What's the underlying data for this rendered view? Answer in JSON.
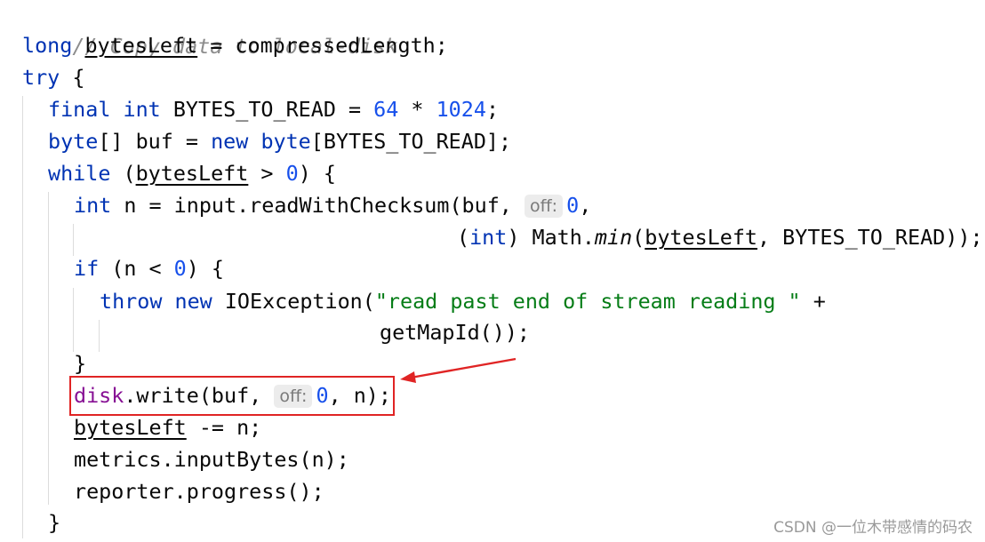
{
  "code": {
    "comment": "// Copy data to local-disk",
    "l1_kw": "long",
    "l1_var": "bytesLeft",
    "l1_rest": " = compressedLength;",
    "l2_kw": "try",
    "l2_rest": " {",
    "l3_kw1": "final",
    "l3_kw2": "int",
    "l3_mid": " BYTES_TO_READ = ",
    "l3_n1": "64",
    "l3_op": " * ",
    "l3_n2": "1024",
    "l3_end": ";",
    "l4_kw1": "byte",
    "l4_mid1": "[] buf = ",
    "l4_kw2": "new",
    "l4_kw3": "byte",
    "l4_end": "[BYTES_TO_READ];",
    "l5_kw": "while",
    "l5_a": " (",
    "l5_var": "bytesLeft",
    "l5_b": " > ",
    "l5_n": "0",
    "l5_c": ") {",
    "l6_kw": "int",
    "l6_a": " n = input.readWithChecksum(buf, ",
    "l6_hint": "off:",
    "l6_n": "0",
    "l6_end": ",",
    "l7_a": "(",
    "l7_kw": "int",
    "l7_b": ") Math.",
    "l7_fn": "min",
    "l7_c": "(",
    "l7_var": "bytesLeft",
    "l7_d": ", BYTES_TO_READ));",
    "l8_kw": "if",
    "l8_a": " (n < ",
    "l8_n": "0",
    "l8_b": ") {",
    "l9_kw1": "throw",
    "l9_kw2": "new",
    "l9_a": " IOException(",
    "l9_str": "\"read past end of stream reading \"",
    "l9_b": " +",
    "l10_a": "getMapId());",
    "l11_a": "}",
    "l12_field": "disk",
    "l12_a": ".write(buf, ",
    "l12_hint": "off:",
    "l12_n": "0",
    "l12_b": ", n);",
    "l13_var": "bytesLeft",
    "l13_a": " -= n;",
    "l14_a": "metrics.inputBytes(n);",
    "l15_a": "reporter.progress();",
    "l16_a": "}"
  },
  "colors": {
    "keyword": "#0033b3",
    "number": "#1750eb",
    "string": "#067d17",
    "comment": "#8c8c8c",
    "field": "#871094",
    "annotation": "#e02424"
  },
  "watermark": "CSDN @一位木带感情的码农"
}
